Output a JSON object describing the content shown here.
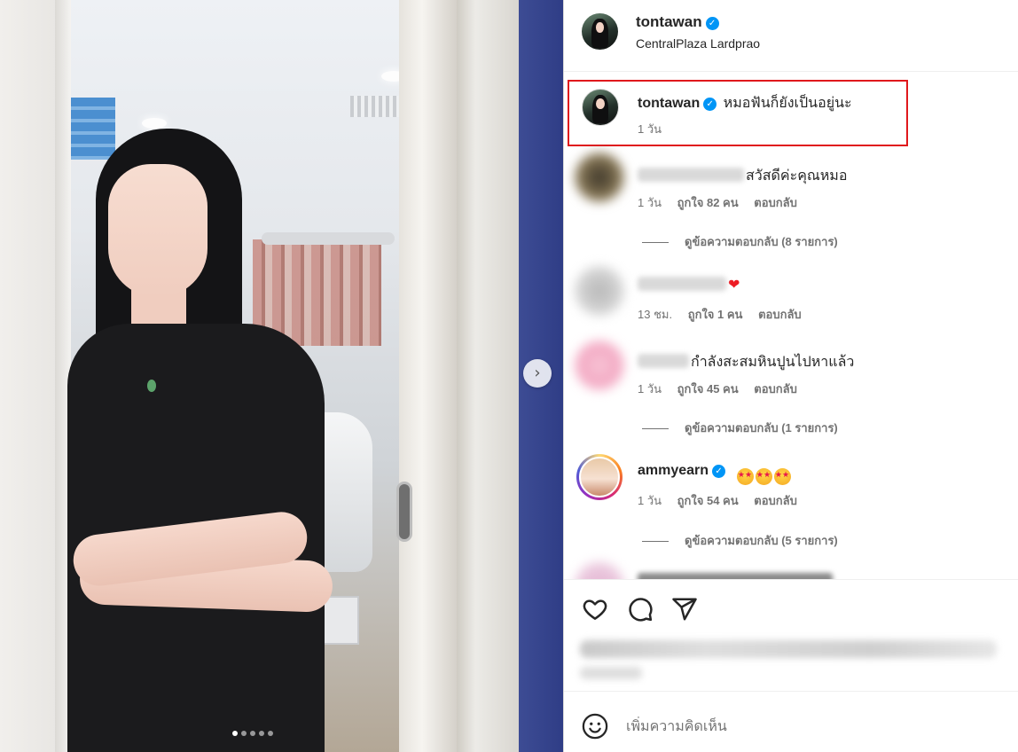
{
  "post": {
    "username": "tontawan",
    "location": "CentralPlaza Lardprao",
    "verified_icon": "verified-badge-icon",
    "carousel": {
      "total_slides": 5,
      "active_slide": 1
    }
  },
  "caption": {
    "username": "tontawan",
    "text": "หมอฟันก็ยังเป็นอยู่นะ",
    "time": "1 วัน"
  },
  "comments": [
    {
      "text": "สวัสดีค่ะคุณหมอ",
      "time": "1 วัน",
      "likes": "ถูกใจ 82 คน",
      "reply": "ตอบกลับ",
      "view_replies": "ดูข้อความตอบกลับ (8 รายการ)"
    },
    {
      "text": "",
      "time": "13 ชม.",
      "likes": "ถูกใจ 1 คน",
      "reply": "ตอบกลับ"
    },
    {
      "text": "กำลังสะสมหินปูนไปหาแล้ว",
      "time": "1 วัน",
      "likes": "ถูกใจ 45 คน",
      "reply": "ตอบกลับ",
      "view_replies": "ดูข้อความตอบกลับ (1 รายการ)"
    },
    {
      "username": "ammyearn",
      "time": "1 วัน",
      "likes": "ถูกใจ 54 คน",
      "reply": "ตอบกลับ",
      "view_replies": "ดูข้อความตอบกลับ (5 รายการ)"
    }
  ],
  "add_comment": {
    "placeholder": "เพิ่มความคิดเห็น"
  },
  "colors": {
    "highlight_box": "#e0181c",
    "verified": "#0095f6",
    "heart": "#ed1c24"
  },
  "icons": [
    "heart-icon",
    "comment-icon",
    "share-icon",
    "emoji-icon",
    "chevron-right-icon"
  ]
}
